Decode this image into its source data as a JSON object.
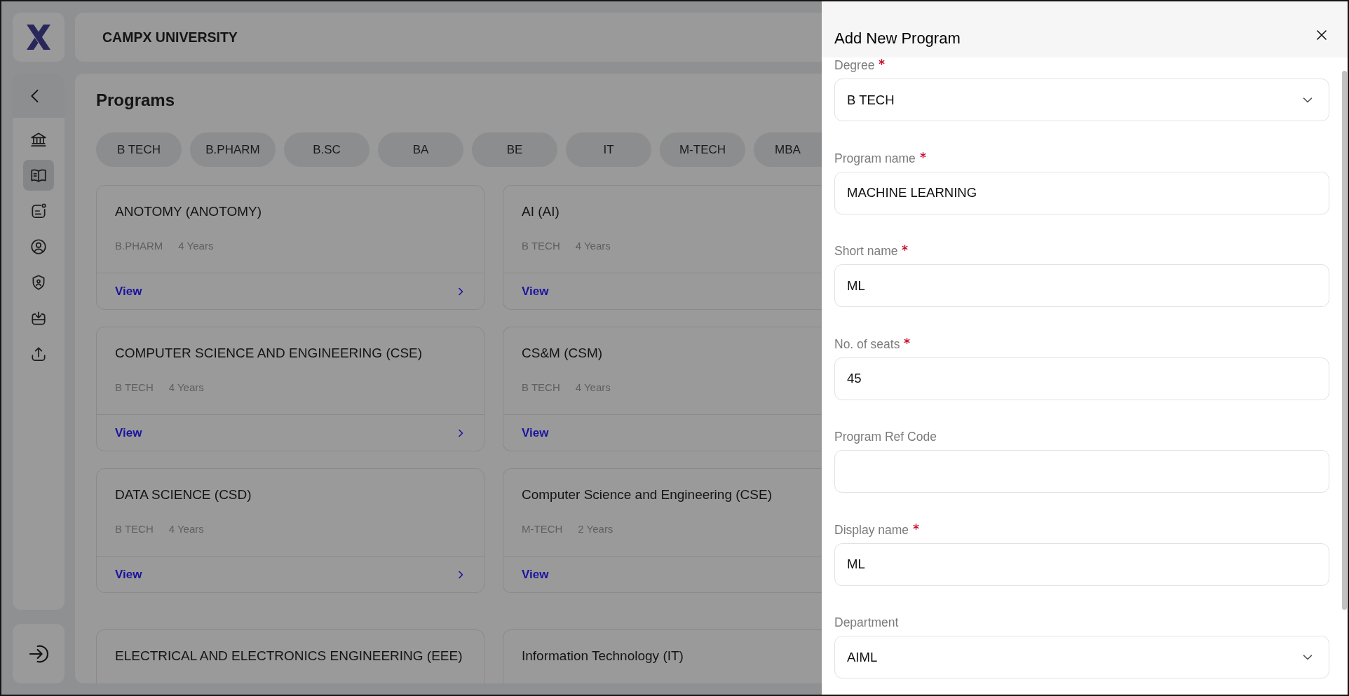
{
  "sidebar": {
    "nav_items": [
      {
        "selected": false
      },
      {
        "selected": true
      },
      {
        "selected": false
      },
      {
        "selected": false
      },
      {
        "selected": false
      },
      {
        "selected": false
      },
      {
        "selected": false
      }
    ]
  },
  "header": {
    "title": "CAMPX UNIVERSITY"
  },
  "programs": {
    "title": "Programs",
    "filters": [
      {
        "label": "B TECH",
        "selected": false
      },
      {
        "label": "B.PHARM",
        "selected": false
      },
      {
        "label": "B.SC",
        "selected": false
      },
      {
        "label": "BA",
        "selected": false
      },
      {
        "label": "BE",
        "selected": false
      },
      {
        "label": "IT",
        "selected": false
      },
      {
        "label": "M-TECH",
        "selected": false
      },
      {
        "label": "MBA",
        "selected": false
      }
    ],
    "cards": [
      {
        "title": "ANOTOMY (ANOTOMY)",
        "degree": "B.PHARM",
        "duration": "4 Years",
        "action": "View"
      },
      {
        "title": "AI (AI)",
        "degree": "B TECH",
        "duration": "4 Years",
        "action": "View"
      },
      {
        "title": "COMPUTER SCIENCE AND ENGINEERING (CSE)",
        "degree": "B TECH",
        "duration": "4 Years",
        "action": "View"
      },
      {
        "title": "CS&M (CSM)",
        "degree": "B TECH",
        "duration": "4 Years",
        "action": "View"
      },
      {
        "title": "DATA SCIENCE (CSD)",
        "degree": "B TECH",
        "duration": "4 Years",
        "action": "View"
      },
      {
        "title": "Computer Science and Engineering (CSE)",
        "degree": "M-TECH",
        "duration": "2 Years",
        "action": "View"
      },
      {
        "title": "ELECTRICAL AND ELECTRONICS ENGINEERING (EEE)"
      },
      {
        "title": "Information Technology (IT)"
      }
    ]
  },
  "drawer": {
    "title": "Add New Program",
    "fields": [
      {
        "label": "Degree",
        "required": true,
        "kind": "select",
        "value": "B TECH"
      },
      {
        "label": "Program name",
        "required": true,
        "kind": "text",
        "value": "MACHINE LEARNING"
      },
      {
        "label": "Short name",
        "required": true,
        "kind": "text",
        "value": "ML"
      },
      {
        "label": "No. of seats",
        "required": true,
        "kind": "text",
        "value": "45"
      },
      {
        "label": "Program Ref Code",
        "required": false,
        "kind": "text"
      },
      {
        "label": "Display name",
        "required": true,
        "kind": "text",
        "value": "ML"
      },
      {
        "label": "Department",
        "required": false,
        "kind": "select",
        "value": "AIML"
      }
    ]
  }
}
